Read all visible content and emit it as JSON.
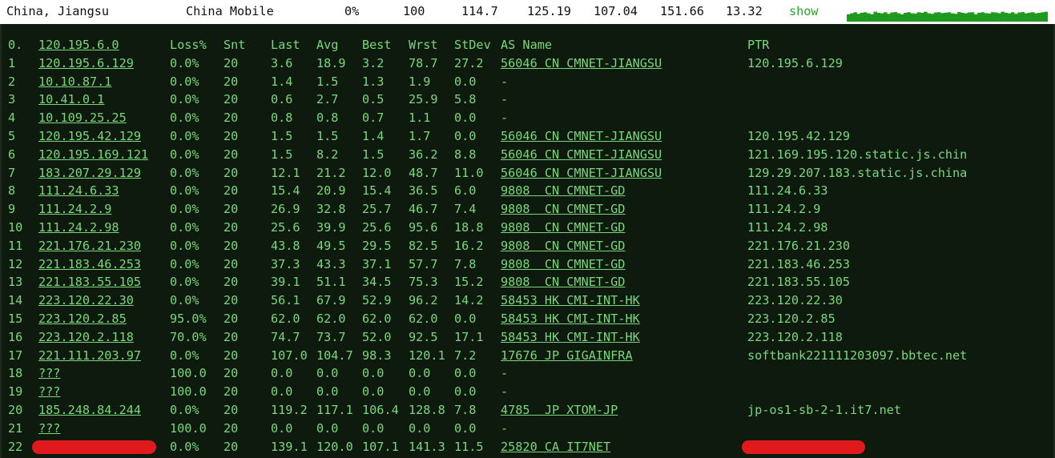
{
  "header": {
    "location": "China, Jiangsu",
    "isp": "China Mobile",
    "loss": "0%",
    "sent": "100",
    "last": "114.7",
    "avg": "125.19",
    "best": "107.04",
    "worst": "151.66",
    "stdev": "13.32",
    "show_label": "show"
  },
  "columns": {
    "num": "0.",
    "host": "120.195.6.0",
    "loss": "Loss%",
    "snt": "Snt",
    "last": "Last",
    "avg": "Avg",
    "best": "Best",
    "wrst": "Wrst",
    "stdev": "StDev",
    "asname": "AS Name",
    "ptr": "PTR"
  },
  "rows": [
    {
      "num": "1",
      "host": "120.195.6.129",
      "loss": "0.0%",
      "snt": "20",
      "last": "3.6",
      "avg": "18.9",
      "best": "3.2",
      "wrst": "78.7",
      "stdev": "27.2",
      "asname": "56046 CN CMNET-JIANGSU",
      "ptr": "120.195.6.129"
    },
    {
      "num": "2",
      "host": "10.10.87.1",
      "loss": "0.0%",
      "snt": "20",
      "last": "1.4",
      "avg": "1.5",
      "best": "1.3",
      "wrst": "1.9",
      "stdev": "0.0",
      "asname": "-",
      "ptr": ""
    },
    {
      "num": "3",
      "host": "10.41.0.1",
      "loss": "0.0%",
      "snt": "20",
      "last": "0.6",
      "avg": "2.7",
      "best": "0.5",
      "wrst": "25.9",
      "stdev": "5.8",
      "asname": "-",
      "ptr": ""
    },
    {
      "num": "4",
      "host": "10.109.25.25",
      "loss": "0.0%",
      "snt": "20",
      "last": "0.8",
      "avg": "0.8",
      "best": "0.7",
      "wrst": "1.1",
      "stdev": "0.0",
      "asname": "-",
      "ptr": ""
    },
    {
      "num": "5",
      "host": "120.195.42.129",
      "loss": "0.0%",
      "snt": "20",
      "last": "1.5",
      "avg": "1.5",
      "best": "1.4",
      "wrst": "1.7",
      "stdev": "0.0",
      "asname": "56046 CN CMNET-JIANGSU",
      "ptr": "120.195.42.129"
    },
    {
      "num": "6",
      "host": "120.195.169.121",
      "loss": "0.0%",
      "snt": "20",
      "last": "1.5",
      "avg": "8.2",
      "best": "1.5",
      "wrst": "36.2",
      "stdev": "8.8",
      "asname": "56046 CN CMNET-JIANGSU",
      "ptr": "121.169.195.120.static.js.chin"
    },
    {
      "num": "7",
      "host": "183.207.29.129",
      "loss": "0.0%",
      "snt": "20",
      "last": "12.1",
      "avg": "21.2",
      "best": "12.0",
      "wrst": "48.7",
      "stdev": "11.0",
      "asname": "56046 CN CMNET-JIANGSU",
      "ptr": "129.29.207.183.static.js.china"
    },
    {
      "num": "8",
      "host": "111.24.6.33",
      "loss": "0.0%",
      "snt": "20",
      "last": "15.4",
      "avg": "20.9",
      "best": "15.4",
      "wrst": "36.5",
      "stdev": "6.0",
      "asname": "9808  CN CMNET-GD",
      "ptr": "111.24.6.33"
    },
    {
      "num": "9",
      "host": "111.24.2.9",
      "loss": "0.0%",
      "snt": "20",
      "last": "26.9",
      "avg": "32.8",
      "best": "25.7",
      "wrst": "46.7",
      "stdev": "7.4",
      "asname": "9808  CN CMNET-GD",
      "ptr": "111.24.2.9"
    },
    {
      "num": "10",
      "host": "111.24.2.98",
      "loss": "0.0%",
      "snt": "20",
      "last": "25.6",
      "avg": "39.9",
      "best": "25.6",
      "wrst": "95.6",
      "stdev": "18.8",
      "asname": "9808  CN CMNET-GD",
      "ptr": "111.24.2.98"
    },
    {
      "num": "11",
      "host": "221.176.21.230",
      "loss": "0.0%",
      "snt": "20",
      "last": "43.8",
      "avg": "49.5",
      "best": "29.5",
      "wrst": "82.5",
      "stdev": "16.2",
      "asname": "9808  CN CMNET-GD",
      "ptr": "221.176.21.230"
    },
    {
      "num": "12",
      "host": "221.183.46.253",
      "loss": "0.0%",
      "snt": "20",
      "last": "37.3",
      "avg": "43.3",
      "best": "37.1",
      "wrst": "57.7",
      "stdev": "7.8",
      "asname": "9808  CN CMNET-GD",
      "ptr": "221.183.46.253"
    },
    {
      "num": "13",
      "host": "221.183.55.105",
      "loss": "0.0%",
      "snt": "20",
      "last": "39.1",
      "avg": "51.1",
      "best": "34.5",
      "wrst": "75.3",
      "stdev": "15.2",
      "asname": "9808  CN CMNET-GD",
      "ptr": "221.183.55.105"
    },
    {
      "num": "14",
      "host": "223.120.22.30",
      "loss": "0.0%",
      "snt": "20",
      "last": "56.1",
      "avg": "67.9",
      "best": "52.9",
      "wrst": "96.2",
      "stdev": "14.2",
      "asname": "58453 HK CMI-INT-HK",
      "ptr": "223.120.22.30"
    },
    {
      "num": "15",
      "host": "223.120.2.85",
      "loss": "95.0%",
      "snt": "20",
      "last": "62.0",
      "avg": "62.0",
      "best": "62.0",
      "wrst": "62.0",
      "stdev": "0.0",
      "asname": "58453 HK CMI-INT-HK",
      "ptr": "223.120.2.85"
    },
    {
      "num": "16",
      "host": "223.120.2.118",
      "loss": "70.0%",
      "snt": "20",
      "last": "74.7",
      "avg": "73.7",
      "best": "52.0",
      "wrst": "92.5",
      "stdev": "17.1",
      "asname": "58453 HK CMI-INT-HK",
      "ptr": "223.120.2.118"
    },
    {
      "num": "17",
      "host": "221.111.203.97",
      "loss": "0.0%",
      "snt": "20",
      "last": "107.0",
      "avg": "104.7",
      "best": "98.3",
      "wrst": "120.1",
      "stdev": "7.2",
      "asname": "17676 JP GIGAINFRA",
      "ptr": "softbank221111203097.bbtec.net"
    },
    {
      "num": "18",
      "host": "???",
      "loss": "100.0",
      "snt": "20",
      "last": "0.0",
      "avg": "0.0",
      "best": "0.0",
      "wrst": "0.0",
      "stdev": "0.0",
      "asname": "-",
      "ptr": ""
    },
    {
      "num": "19",
      "host": "???",
      "loss": "100.0",
      "snt": "20",
      "last": "0.0",
      "avg": "0.0",
      "best": "0.0",
      "wrst": "0.0",
      "stdev": "0.0",
      "asname": "-",
      "ptr": ""
    },
    {
      "num": "20",
      "host": "185.248.84.244",
      "loss": "0.0%",
      "snt": "20",
      "last": "119.2",
      "avg": "117.1",
      "best": "106.4",
      "wrst": "128.8",
      "stdev": "7.8",
      "asname": "4785  JP XTOM-JP",
      "ptr": "jp-os1-sb-2-1.it7.net"
    },
    {
      "num": "21",
      "host": "???",
      "loss": "100.0",
      "snt": "20",
      "last": "0.0",
      "avg": "0.0",
      "best": "0.0",
      "wrst": "0.0",
      "stdev": "0.0",
      "asname": "-",
      "ptr": ""
    },
    {
      "num": "22",
      "host": "",
      "loss": "0.0%",
      "snt": "20",
      "last": "139.1",
      "avg": "120.0",
      "best": "107.1",
      "wrst": "141.3",
      "stdev": "11.5",
      "asname": "25820 CA IT7NET",
      "ptr": ""
    }
  ],
  "redactions": [
    "hop-22-host",
    "hop-22-ptr"
  ],
  "sparkline": [
    0.7,
    0.8,
    0.9,
    0.75,
    0.85,
    0.9,
    0.8,
    0.7,
    0.95,
    0.85,
    0.8,
    0.9,
    0.75,
    0.88,
    0.92,
    0.8,
    0.7,
    0.85,
    0.9,
    0.8,
    0.78,
    0.9,
    0.85,
    0.95,
    0.8,
    0.75,
    0.88,
    0.9,
    0.82,
    0.86,
    0.9,
    0.8,
    0.75,
    0.92,
    0.85,
    0.8,
    0.88,
    0.9,
    0.7,
    0.85,
    0.9,
    0.82,
    0.78,
    0.9,
    0.88,
    0.8,
    0.95,
    0.85,
    0.8,
    0.9,
    0.75,
    0.88,
    0.92,
    0.8,
    0.86,
    0.9,
    0.8,
    0.85,
    0.9,
    0.95
  ],
  "colors": {
    "terminal_bg": "#0e1a0e",
    "text_green": "#7bd77b",
    "header_green": "#2aa52a",
    "spark_green": "#1f9a1f",
    "redact_red": "#e0191c"
  }
}
